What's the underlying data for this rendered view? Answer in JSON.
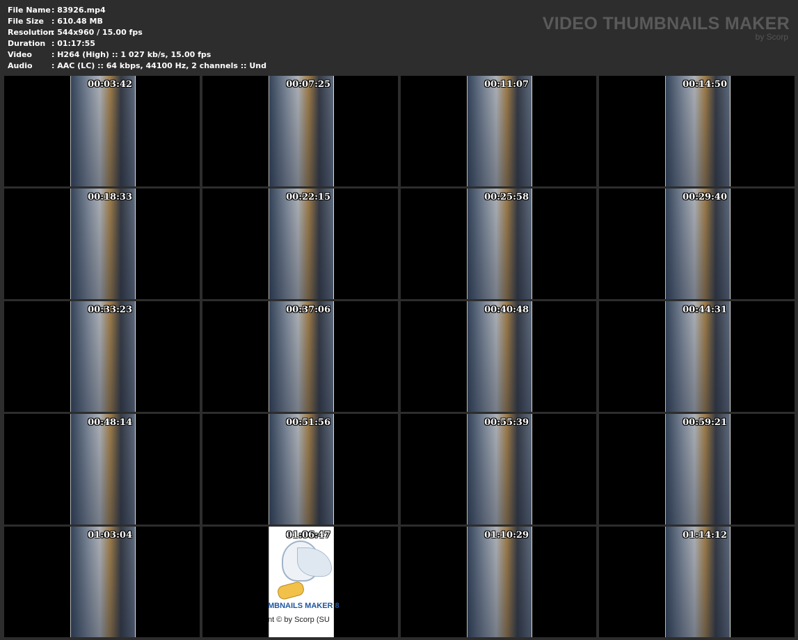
{
  "info": [
    {
      "key": "File Name",
      "value": ": 83926.mp4"
    },
    {
      "key": "File Size",
      "value": ": 610.48 MB"
    },
    {
      "key": "Resolution",
      "value": ": 544x960 / 15.00 fps"
    },
    {
      "key": "Duration",
      "value": ": 01:17:55"
    },
    {
      "key": "Video",
      "value": ": H264 (High) :: 1 027 kb/s, 15.00 fps"
    },
    {
      "key": "Audio",
      "value": ": AAC (LC) :: 64 kbps, 44100 Hz, 2 channels :: Und"
    }
  ],
  "brand": {
    "title": "VIDEO THUMBNAILS MAKER",
    "subtitle": "by Scorp"
  },
  "thumbnails": [
    {
      "time": "00:03:42"
    },
    {
      "time": "00:07:25"
    },
    {
      "time": "00:11:07"
    },
    {
      "time": "00:14:50"
    },
    {
      "time": "00:18:33"
    },
    {
      "time": "00:22:15"
    },
    {
      "time": "00:25:58"
    },
    {
      "time": "00:29:40"
    },
    {
      "time": "00:33:23"
    },
    {
      "time": "00:37:06"
    },
    {
      "time": "00:40:48"
    },
    {
      "time": "00:44:31"
    },
    {
      "time": "00:48:14"
    },
    {
      "time": "00:51:56"
    },
    {
      "time": "00:55:39"
    },
    {
      "time": "00:59:21"
    },
    {
      "time": "01:03:04"
    },
    {
      "time": "01:06:47",
      "logo": true,
      "logo_line1": "MBNAILS MAKER 8",
      "logo_line2": "nt © by Scorp (SU"
    },
    {
      "time": "01:10:29"
    },
    {
      "time": "01:14:12"
    }
  ]
}
